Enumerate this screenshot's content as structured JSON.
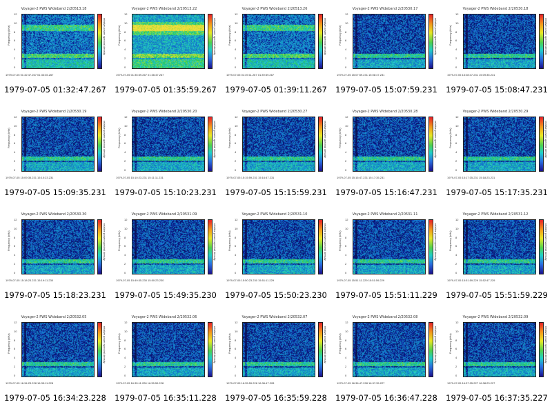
{
  "colors": {
    "high": "#e8202a",
    "mid": "#4fd14f",
    "low": "#1a0f8c",
    "background": "#ffffff"
  },
  "cells": [
    {
      "title": "Voyager-2 PWS Wideband 2/20513.18",
      "caption": "1979-07-05 01:32:47.267",
      "footer": "1979-07-05 01:32:47.267  01:33:35.267"
    },
    {
      "title": "Voyager-2 PWS Wideband 2/20513.22",
      "caption": "1979-07-05 01:35:59.267",
      "footer": "1979-07-05 01:35:59.267  01:36:47.267"
    },
    {
      "title": "Voyager-2 PWS Wideband 2/20513.26",
      "caption": "1979-07-05 01:39:11.267",
      "footer": "1979-07-05 01:39:11.267  01:39:59.267"
    },
    {
      "title": "Voyager-2 PWS Wideband 2/20530.17",
      "caption": "1979-07-05 15:07:59.231",
      "footer": "1979-07-05 15:07:59.231  15:08:47.231"
    },
    {
      "title": "Voyager-2 PWS Wideband 2/20530.18",
      "caption": "1979-07-05 15:08:47.231",
      "footer": "1979-07-05 15:08:47.231  15:09:35.231"
    },
    {
      "title": "Voyager-2 PWS Wideband 2/20530.19",
      "caption": "1979-07-05 15:09:35.231",
      "footer": "1979-07-05 15:09:35.231  15:10:23.231"
    },
    {
      "title": "Voyager-2 PWS Wideband 2/20530.20",
      "caption": "1979-07-05 15:10:23.231",
      "footer": "1979-07-05 15:10:23.231  15:11:11.231"
    },
    {
      "title": "Voyager-2 PWS Wideband 2/20530.27",
      "caption": "1979-07-05 15:15:59.231",
      "footer": "1979-07-05 15:15:59.231  15:16:47.231"
    },
    {
      "title": "Voyager-2 PWS Wideband 2/20530.28",
      "caption": "1979-07-05 15:16:47.231",
      "footer": "1979-07-05 15:16:47.231  15:17:35.231"
    },
    {
      "title": "Voyager-2 PWS Wideband 2/20530.29",
      "caption": "1979-07-05 15:17:35.231",
      "footer": "1979-07-05 15:17:35.231  15:18:23.231"
    },
    {
      "title": "Voyager-2 PWS Wideband 2/20530.30",
      "caption": "1979-07-05 15:18:23.231",
      "footer": "1979-07-05 15:18:23.231  15:19:11.230"
    },
    {
      "title": "Voyager-2 PWS Wideband 2/20531.09",
      "caption": "1979-07-05 15:49:35.230",
      "footer": "1979-07-05 15:49:35.230  15:50:23.230"
    },
    {
      "title": "Voyager-2 PWS Wideband 2/20531.10",
      "caption": "1979-07-05 15:50:23.230",
      "footer": "1979-07-05 15:50:23.230  15:51:11.229"
    },
    {
      "title": "Voyager-2 PWS Wideband 2/20531.11",
      "caption": "1979-07-05 15:51:11.229",
      "footer": "1979-07-05 15:51:11.229  15:51:59.229"
    },
    {
      "title": "Voyager-2 PWS Wideband 2/20531.12",
      "caption": "1979-07-05 15:51:59.229",
      "footer": "1979-07-05 15:51:59.229  15:52:47.229"
    },
    {
      "title": "Voyager-2 PWS Wideband 2/20532.05",
      "caption": "1979-07-05 16:34:23.228",
      "footer": "1979-07-05 16:34:23.228  16:35:11.228"
    },
    {
      "title": "Voyager-2 PWS Wideband 2/20532.06",
      "caption": "1979-07-05 16:35:11.228",
      "footer": "1979-07-05 16:35:11.228  16:35:59.228"
    },
    {
      "title": "Voyager-2 PWS Wideband 2/20532.07",
      "caption": "1979-07-05 16:35:59.228",
      "footer": "1979-07-05 16:35:59.228  16:36:47.228"
    },
    {
      "title": "Voyager-2 PWS Wideband 2/20532.08",
      "caption": "1979-07-05 16:36:47.228",
      "footer": "1979-07-05 16:36:47.228  16:37:35.227"
    },
    {
      "title": "Voyager-2 PWS Wideband 2/20532.09",
      "caption": "1979-07-05 16:37:35.227",
      "footer": "1979-07-05 16:37:35.227  16:38:23.227"
    }
  ],
  "axis": {
    "ylabel": "Frequency (kHz)",
    "yticks": [
      "12",
      "10",
      "8",
      "6",
      "4",
      "2",
      "0"
    ],
    "cbar_label": "relative power spectral density"
  }
}
